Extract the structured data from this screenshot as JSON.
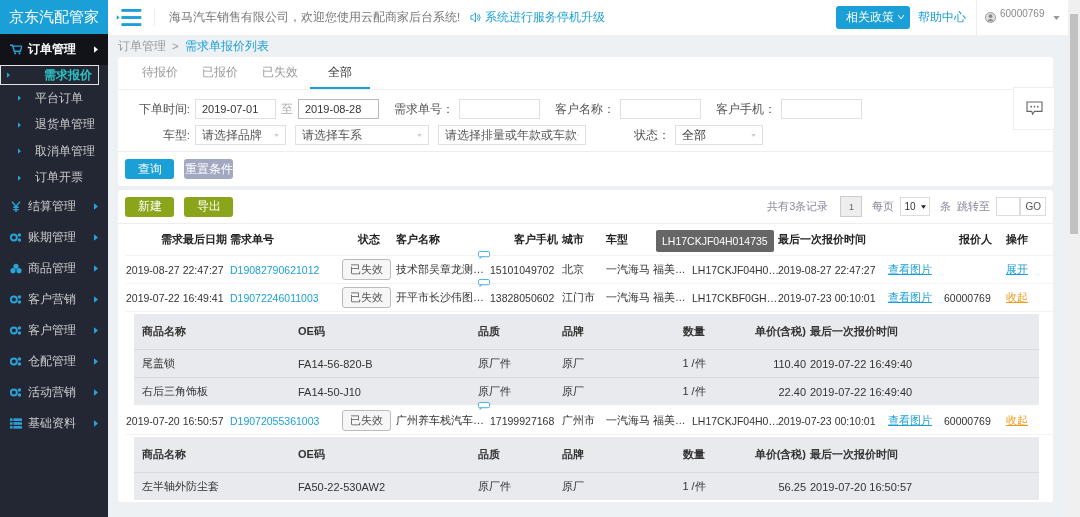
{
  "sidebar": {
    "logo": "京东汽配管家",
    "items": [
      {
        "label": "订单管理",
        "expanded": true,
        "children": [
          {
            "label": "需求报价",
            "selected": true
          },
          {
            "label": "平台订单",
            "selected": false
          },
          {
            "label": "退货单管理",
            "selected": false
          },
          {
            "label": "取消单管理",
            "selected": false
          },
          {
            "label": "订单开票",
            "selected": false
          }
        ]
      },
      {
        "label": "结算管理",
        "expanded": false
      },
      {
        "label": "账期管理",
        "expanded": false
      },
      {
        "label": "商品管理",
        "expanded": false
      },
      {
        "label": "客户营销",
        "expanded": false
      },
      {
        "label": "客户管理",
        "expanded": false
      },
      {
        "label": "仓配管理",
        "expanded": false
      },
      {
        "label": "活动营销",
        "expanded": false
      },
      {
        "label": "基础资料",
        "expanded": false
      }
    ]
  },
  "topbar": {
    "welcome": "海马汽车销售有限公司，欢迎您使用云配商家后台系统!",
    "notice": "系统进行服务停机升级",
    "policy_button": "相关政策",
    "help": "帮助中心",
    "user": "60000769"
  },
  "breadcrumb": {
    "items": [
      "订单管理",
      "需求单报价列表"
    ],
    "separator": ">"
  },
  "tabs": [
    {
      "label": "待报价",
      "selected": false
    },
    {
      "label": "已报价",
      "selected": false
    },
    {
      "label": "已失效",
      "selected": false
    },
    {
      "label": "全部",
      "selected": true
    }
  ],
  "filters": {
    "date_label": "下单时间:",
    "date_from": "2019-07-01",
    "date_to_label": "至",
    "date_to": "2019-08-28",
    "order_no_label": "需求单号：",
    "customer_label": "客户名称：",
    "phone_label": "客户手机：",
    "car_label": "车型:",
    "brand_placeholder": "请选择品牌",
    "series_placeholder": "请选择车系",
    "model_placeholder": "请选择排量或年款或车款",
    "status_label": "状态：",
    "status_value": "全部"
  },
  "buttons": {
    "search": "查询",
    "reset": "重置条件",
    "create": "新建",
    "export": "导出"
  },
  "pagination": {
    "total": "共有3条记录",
    "page": "1",
    "per_page_label": "每页",
    "per_page": "10",
    "unit": "条",
    "jump_label": "跳转至",
    "go": "GO"
  },
  "tooltip": "LH17CKJF04H014735",
  "table": {
    "columns": [
      "需求最后日期",
      "需求单号",
      "状态",
      "客户名称",
      "客户手机",
      "城市",
      "车型",
      "",
      "最后一次报价时间",
      "",
      "报价人",
      "操作"
    ],
    "rows": [
      {
        "date": "2019-08-27 22:47:27",
        "order_no": "D19082790621012",
        "status": "已失效",
        "customer": "技术部吴章龙测…",
        "phone": "15101049702",
        "city": "北京",
        "car": "一汽海马 福美…",
        "vin": "LH17CKJF04H0…",
        "quote_time": "2019-08-27 22:47:27",
        "pictures": "查看图片",
        "quoter": "",
        "action": "展开",
        "expanded": false
      },
      {
        "date": "2019-07-22 16:49:41",
        "order_no": "D19072246011003",
        "status": "已失效",
        "customer": "开平市长沙伟图…",
        "phone": "13828050602",
        "city": "江门市",
        "car": "一汽海马 福美…",
        "vin": "LH17CKBF0GH…",
        "quote_time": "2019-07-23 00:10:01",
        "pictures": "查看图片",
        "quoter": "60000769",
        "action": "收起",
        "expanded": true,
        "items": {
          "columns": [
            "商品名称",
            "OE码",
            "品质",
            "品牌",
            "数量",
            "单价(含税)",
            "最后一次报价时间"
          ],
          "rows": [
            [
              "尾盖锁",
              "FA14-56-820-B",
              "原厂件",
              "原厂",
              "1 /件",
              "110.40",
              "2019-07-22 16:49:40"
            ],
            [
              "右后三角饰板",
              "FA14-50-J10",
              "原厂件",
              "原厂",
              "1 /件",
              "22.40",
              "2019-07-22 16:49:40"
            ]
          ]
        }
      },
      {
        "date": "2019-07-20 16:50:57",
        "order_no": "D19072055361003",
        "status": "已失效",
        "customer": "广州养车栈汽车…",
        "phone": "17199927168",
        "city": "广州市",
        "car": "一汽海马 福美…",
        "vin": "LH17CKJF04H0…",
        "quote_time": "2019-07-23 00:10:01",
        "pictures": "查看图片",
        "quoter": "60000769",
        "action": "收起",
        "expanded": true,
        "items": {
          "columns": [
            "商品名称",
            "OE码",
            "品质",
            "品牌",
            "数量",
            "单价(含税)",
            "最后一次报价时间"
          ],
          "rows": [
            [
              "左半轴外防尘套",
              "FA50-22-530AW2",
              "原厂件",
              "原厂",
              "1 /件",
              "56.25",
              "2019-07-20 16:50:57"
            ]
          ]
        }
      }
    ]
  }
}
